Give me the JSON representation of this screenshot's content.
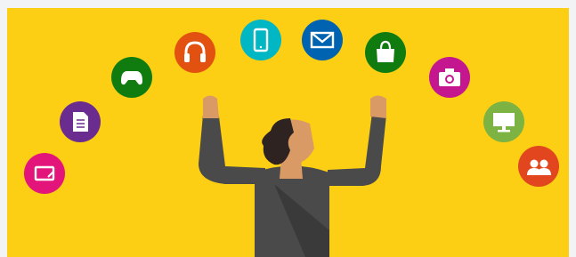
{
  "scene": {
    "background_color": "#FCCF14",
    "frame_color": "#F1F3F5"
  },
  "app_icons": [
    {
      "icon": "tablet-pen-icon",
      "color": "#E3157A"
    },
    {
      "icon": "document-icon",
      "color": "#6B2C8F"
    },
    {
      "icon": "xbox-controller-icon",
      "color": "#107C10"
    },
    {
      "icon": "headphones-icon",
      "color": "#E2510F"
    },
    {
      "icon": "smartphone-icon",
      "color": "#00B7C3"
    },
    {
      "icon": "mail-icon",
      "color": "#0063B1"
    },
    {
      "icon": "store-bag-icon",
      "color": "#107C10"
    },
    {
      "icon": "camera-icon",
      "color": "#C4168F"
    },
    {
      "icon": "monitor-icon",
      "color": "#7CB342"
    },
    {
      "icon": "people-icon",
      "color": "#E1461E"
    }
  ],
  "person": {
    "skin_color": "#D99A66",
    "hair_color": "#2E2321",
    "shirt_color": "#4A4A4A",
    "shirt_shadow": "#3A3A3A"
  }
}
